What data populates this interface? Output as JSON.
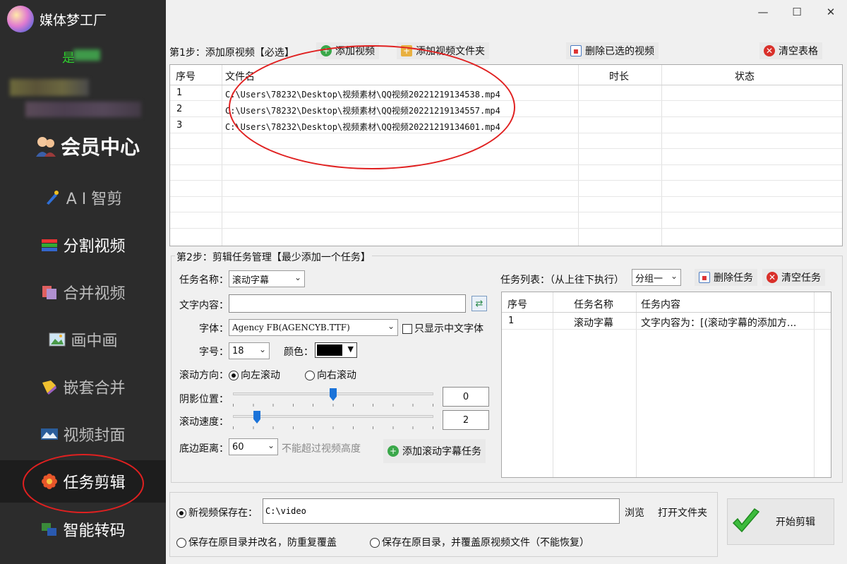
{
  "app": {
    "title": "媒体梦工厂",
    "vip_text": "是",
    "member_center": "会员中心",
    "window_controls": [
      "—",
      "☐",
      "✕"
    ]
  },
  "sidebar": {
    "items": [
      {
        "label": "A I 智剪",
        "icon": "ai-cut-icon"
      },
      {
        "label": "分割视频",
        "icon": "split-video-icon"
      },
      {
        "label": "合并视频",
        "icon": "merge-video-icon"
      },
      {
        "label": "画中画",
        "icon": "picture-in-picture-icon"
      },
      {
        "label": "嵌套合并",
        "icon": "nested-merge-icon"
      },
      {
        "label": "视频封面",
        "icon": "video-cover-icon"
      },
      {
        "label": "任务剪辑",
        "icon": "task-edit-icon"
      },
      {
        "label": "智能转码",
        "icon": "smart-transcode-icon"
      }
    ],
    "active_index": 6
  },
  "step1": {
    "label": "第1步：添加原视频【必选】",
    "add_video": "添加视频",
    "add_folder": "添加视频文件夹",
    "delete_selected": "删除已选的视频",
    "clear_table": "清空表格",
    "columns": [
      "序号",
      "文件名",
      "时长",
      "状态"
    ],
    "rows": [
      {
        "index": "1",
        "file": "C:\\Users\\78232\\Desktop\\视频素材\\QQ视频20221219134538.mp4",
        "duration": "",
        "status": ""
      },
      {
        "index": "2",
        "file": "C:\\Users\\78232\\Desktop\\视频素材\\QQ视频20221219134557.mp4",
        "duration": "",
        "status": ""
      },
      {
        "index": "3",
        "file": "C:\\Users\\78232\\Desktop\\视频素材\\QQ视频20221219134601.mp4",
        "duration": "",
        "status": ""
      }
    ]
  },
  "step2": {
    "label": "第2步：剪辑任务管理【最少添加一个任务】",
    "task_name_label": "任务名称：",
    "task_name_value": "滚动字幕",
    "text_content_label": "文字内容：",
    "text_content_value": "",
    "font_label": "字体：",
    "font_value": "Agency FB(AGENCYB.TTF)",
    "only_chinese_font": "只显示中文字体",
    "size_label": "字号：",
    "size_value": "18",
    "color_label": "颜色：",
    "color_value": "#000000",
    "direction_label": "滚动方向：",
    "direction_left": "向左滚动",
    "direction_right": "向右滚动",
    "shadow_label": "阴影位置：",
    "shadow_value": "0",
    "shadow_level": 0.5,
    "speed_label": "滚动速度：",
    "speed_value": "2",
    "speed_level": 0.12,
    "bottom_label": "底边距离：",
    "bottom_value": "60",
    "bottom_hint": "不能超过视频高度",
    "add_task_button": "添加滚动字幕任务",
    "task_list_label": "任务列表：（从上往下执行）",
    "group_value": "分组一",
    "delete_task": "删除任务",
    "clear_tasks": "清空任务",
    "task_columns": [
      "序号",
      "任务名称",
      "任务内容"
    ],
    "tasks": [
      {
        "index": "1",
        "name": "滚动字幕",
        "content": "文字内容为：[(滚动字幕的添加方..."
      }
    ]
  },
  "output": {
    "save_new_label": "新视频保存在：",
    "save_path": "C:\\video",
    "browse": "浏览",
    "open_folder": "打开文件夹",
    "option_rename": "保存在原目录并改名，防重复覆盖",
    "option_overwrite": "保存在原目录，并覆盖原视频文件（不能恢复）",
    "start_button": "开始剪辑"
  },
  "colors": {
    "sidebar_bg": "#2c2c2c",
    "vip_green": "#2ed12e",
    "annotation_red": "#e02020",
    "slider_blue": "#1a73d9"
  }
}
